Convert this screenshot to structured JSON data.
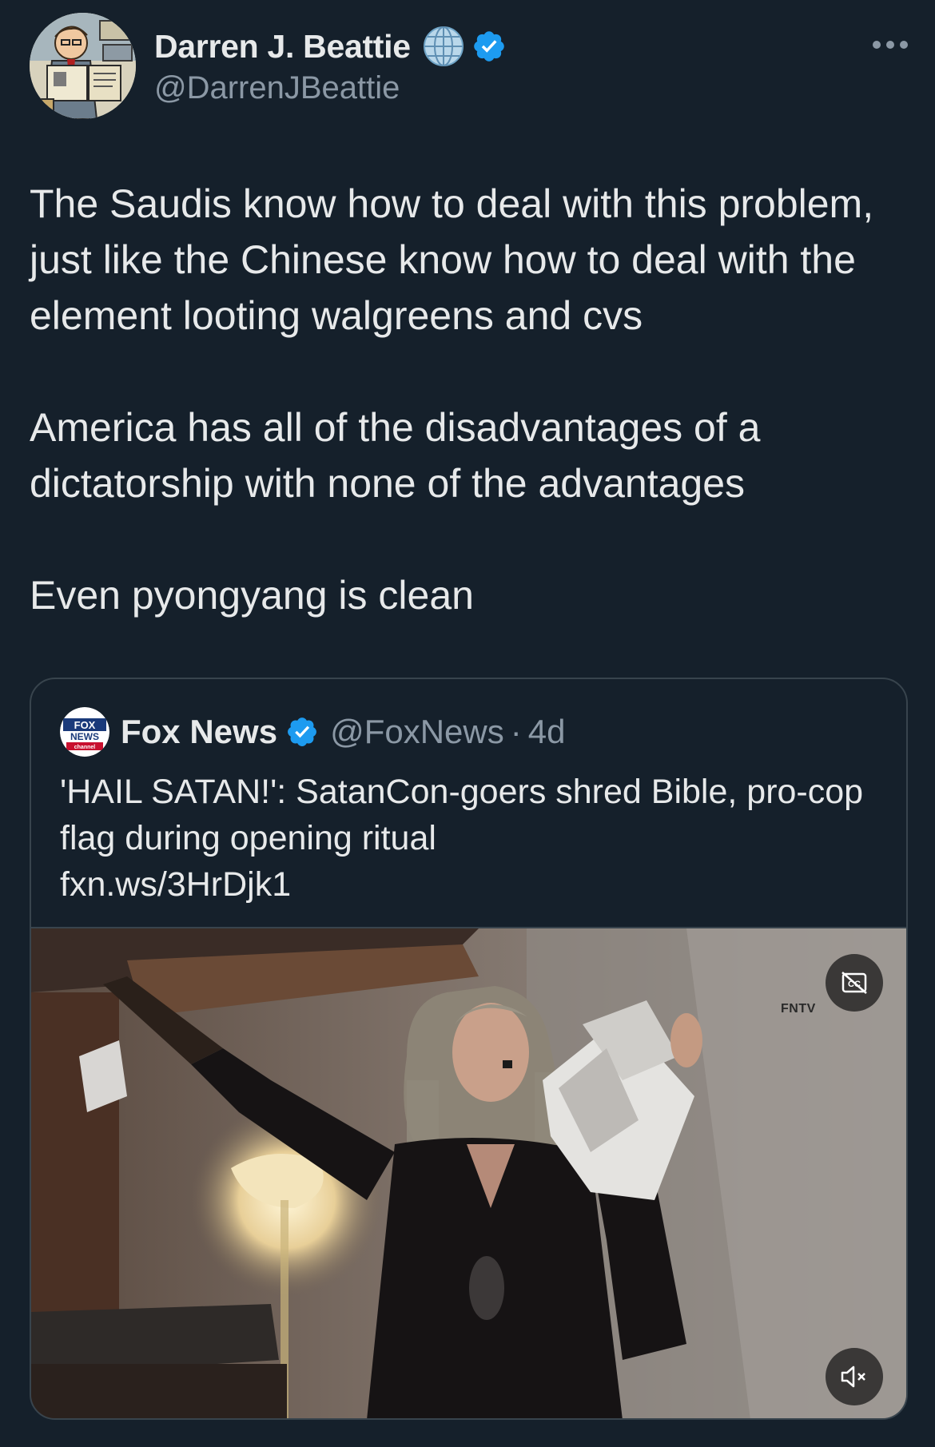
{
  "author": {
    "display_name": "Darren J. Beattie",
    "handle": "@DarrenJBeattie",
    "avatar_icon": "cartoon-avatar-icon",
    "badges": [
      "globe-affiliate-badge",
      "verified-badge"
    ]
  },
  "tweet": {
    "text": "The Saudis know how to deal with this problem, just like the Chinese know how to deal with the element looting walgreens and cvs\n\nAmerica has all of the disadvantages of a dictatorship with none of the advantages\n\nEven pyongyang is clean"
  },
  "quote": {
    "display_name": "Fox News",
    "handle": "@FoxNews",
    "separator": "·",
    "time": "4d",
    "logo_icon": "fox-news-logo-icon",
    "text": "'HAIL SATAN!': SatanCon-goers shred Bible, pro-cop flag during opening ritual",
    "link": "fxn.ws/3HrDjk1",
    "media": {
      "watermark": "FNTV",
      "cc_icon": "closed-captions-off-icon",
      "mute_icon": "muted-speaker-icon"
    }
  },
  "colors": {
    "background": "#15202b",
    "text": "#e7e9ea",
    "secondary_text": "#8b98a5",
    "verified_blue": "#1d9bf0",
    "border": "#38444d"
  }
}
